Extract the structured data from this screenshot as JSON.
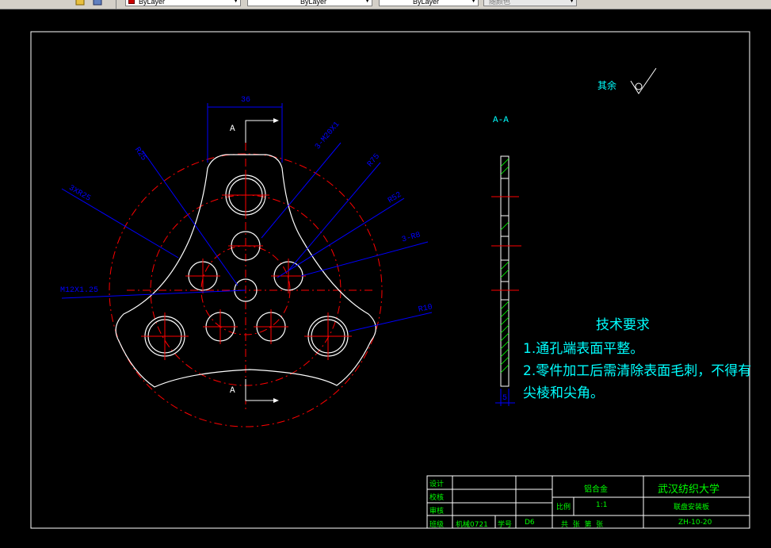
{
  "toolbar": {
    "color_combo": "ByLayer",
    "linetype_combo": "ByLayer",
    "lineweight_combo": "ByLayer",
    "plotstyle_combo": "随颜色"
  },
  "drawing": {
    "section_label": "A-A",
    "section_mark_top": "A",
    "section_mark_bottom": "A",
    "dimensions": {
      "width_36": "36",
      "d_r25": "R25",
      "d_3xm20": "3-M20X1",
      "d_r75": "R75",
      "d_r52": "R52",
      "d_3xr25": "3XR25",
      "d_3r8": "3-R8",
      "d_m12": "M12X1.25",
      "d_r10": "R10",
      "thickness": "5"
    },
    "surface_note": "其余",
    "tech_title": "技术要求",
    "tech_line1": "1.通孔端表面平整。",
    "tech_line2": "2.零件加工后需清除表面毛刺，不得有",
    "tech_line3": "尖棱和尖角。"
  },
  "title_block": {
    "design": "设计",
    "check": "校核",
    "review": "审核",
    "class_label": "班级",
    "class_value": "机械0721",
    "id_label": "学号",
    "id_value": "D6",
    "material": "铝合金",
    "school": "武汉纺织大学",
    "scale_label": "比例",
    "scale_value": "1:1",
    "part_name": "联盘安装板",
    "sheets": "共  张  第  张",
    "drawing_no": "ZH-10-20"
  },
  "colors": {
    "outline": "#ffffff",
    "centerline": "#ff0000",
    "dimension": "#0000ff",
    "text": "#00ffff",
    "hatch": "#00ff00",
    "titleblock_text": "#00ff00"
  }
}
